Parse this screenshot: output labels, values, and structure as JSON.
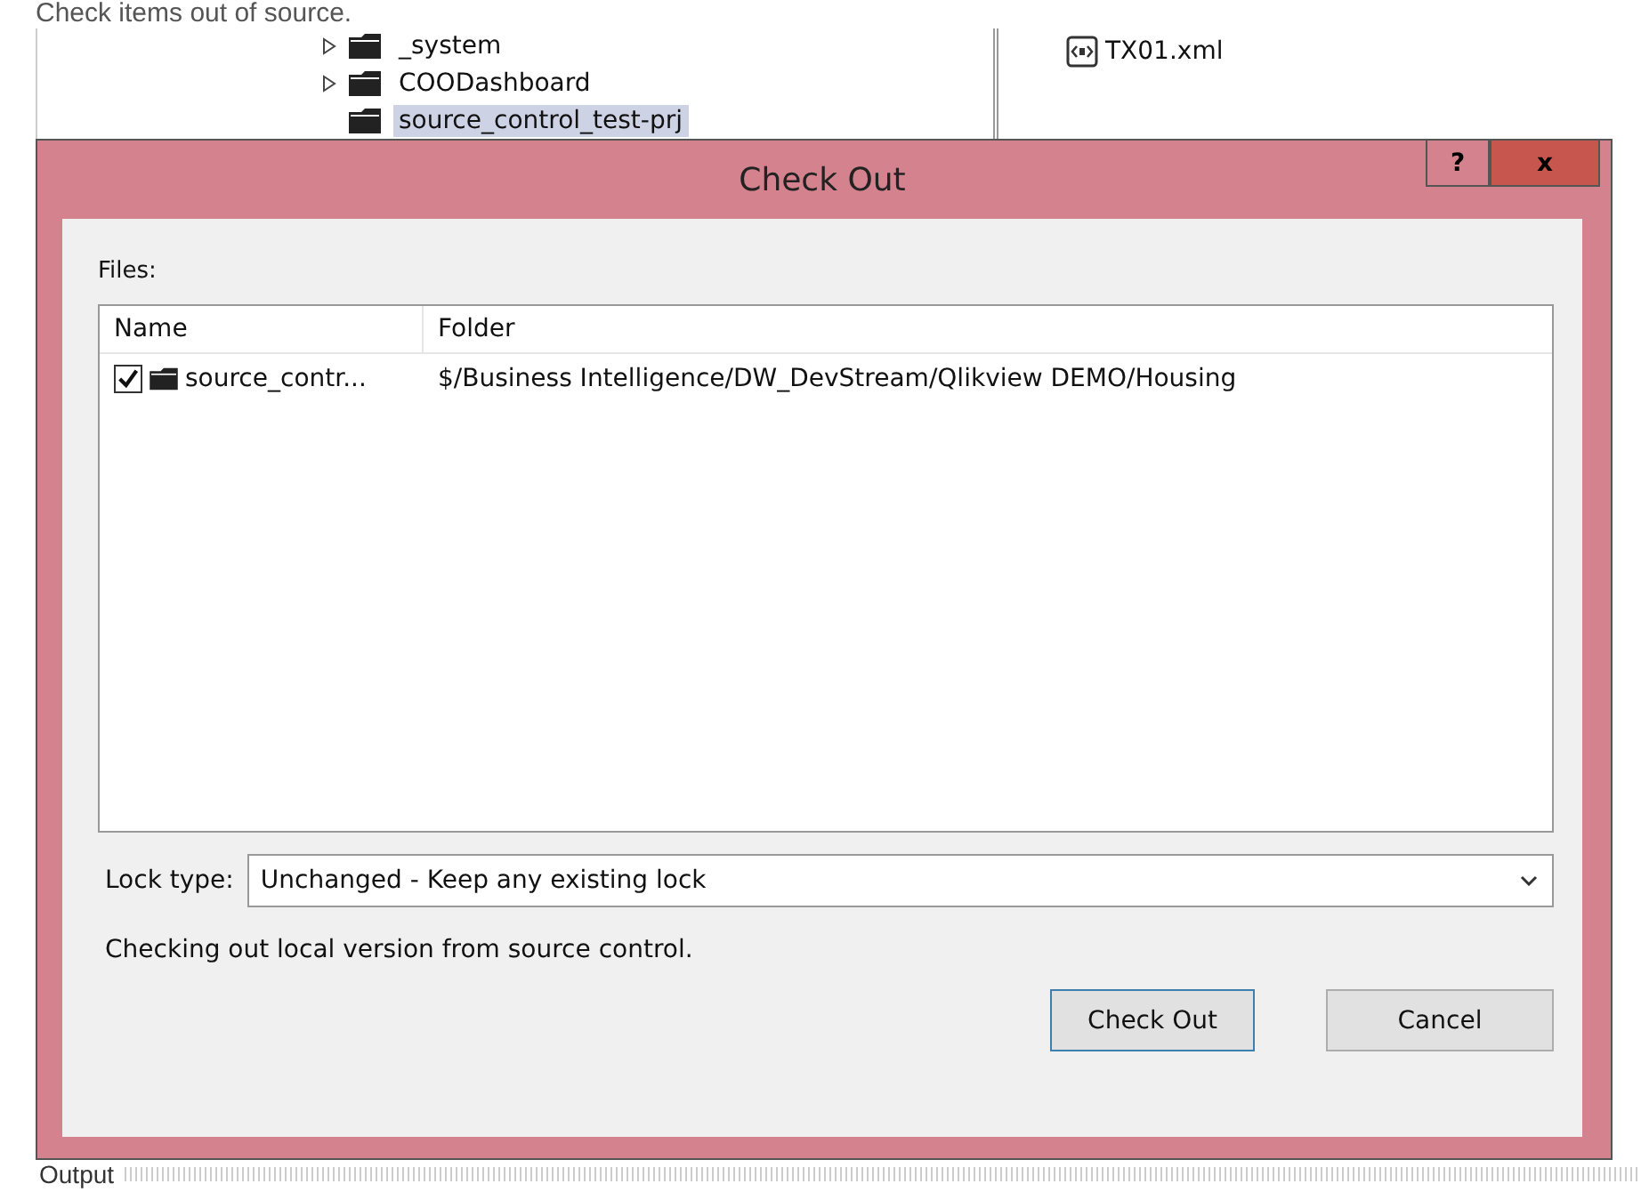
{
  "caption": "Check items out of source.",
  "tree": {
    "items": [
      {
        "label": "_system",
        "has_children": true,
        "selected": false
      },
      {
        "label": "COODashboard",
        "has_children": true,
        "selected": false
      },
      {
        "label": "source_control_test-prj",
        "has_children": false,
        "selected": true
      }
    ]
  },
  "files_pane": {
    "items": [
      {
        "label": "TX01.xml"
      }
    ]
  },
  "dialog": {
    "title": "Check Out",
    "help_button": "?",
    "close_button": "x",
    "files_label": "Files:",
    "table": {
      "columns": [
        "Name",
        "Folder"
      ],
      "rows": [
        {
          "checked": true,
          "name": "source_contr...",
          "folder": "$/Business Intelligence/DW_DevStream/Qlikview DEMO/Housing"
        }
      ]
    },
    "lock_type": {
      "label": "Lock type:",
      "value": "Unchanged - Keep any existing lock"
    },
    "status": "Checking out local version from source control.",
    "buttons": [
      {
        "label": "Check Out",
        "default": true
      },
      {
        "label": "Cancel",
        "default": false
      }
    ]
  },
  "output_panel": {
    "title": "Output"
  }
}
